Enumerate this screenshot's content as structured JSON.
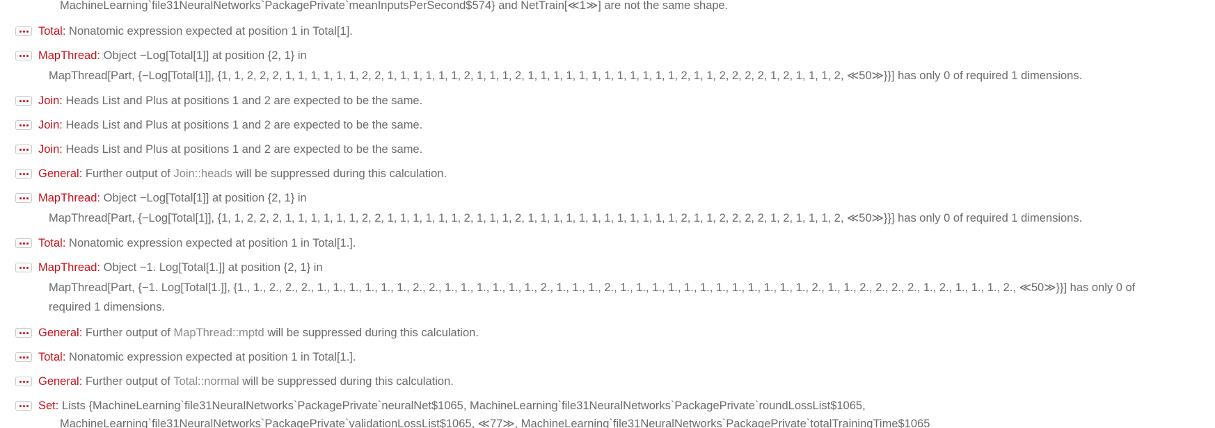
{
  "messages": [
    {
      "line1_text": "MachineLearning`file31NeuralNetworks`PackagePrivate`meanInputsPerSecond$574} and NetTrain[≪1≫] are not the same shape."
    },
    {
      "symbol": "Total:",
      "text": "Nonatomic expression expected at position 1 in Total[1]."
    },
    {
      "symbol": "MapThread:",
      "text": "Object −Log[Total[1]] at position {2, 1} in",
      "line2": "MapThread[Part, {−Log[Total[1]], {1, 1, 2, 2, 2, 1, 1, 1, 1, 1, 1, 2, 2, 1, 1, 1, 1, 1, 1, 2, 1, 1, 1, 2, 1, 1, 1, 1, 1, 1, 1, 1, 1, 1, 1, 1, 2, 1, 1, 2, 2, 2, 2, 1, 2, 1, 1, 1, 2, ≪50≫}}] has only 0 of required 1 dimensions."
    },
    {
      "symbol": "Join:",
      "text": "Heads List and Plus at positions 1 and 2 are expected to be the same."
    },
    {
      "symbol": "Join:",
      "text": "Heads List and Plus at positions 1 and 2 are expected to be the same."
    },
    {
      "symbol": "Join:",
      "text": "Heads List and Plus at positions 1 and 2 are expected to be the same."
    },
    {
      "symbol": "General:",
      "text_before": "Further output of",
      "name": "Join::heads",
      "text_after": "will be suppressed during this calculation."
    },
    {
      "symbol": "MapThread:",
      "text": "Object −Log[Total[1]] at position {2, 1} in",
      "line2": "MapThread[Part, {−Log[Total[1]], {1, 1, 2, 2, 2, 1, 1, 1, 1, 1, 1, 2, 2, 1, 1, 1, 1, 1, 1, 2, 1, 1, 1, 2, 1, 1, 1, 1, 1, 1, 1, 1, 1, 1, 1, 1, 2, 1, 1, 2, 2, 2, 2, 1, 2, 1, 1, 1, 2, ≪50≫}}] has only 0 of required 1 dimensions."
    },
    {
      "symbol": "Total:",
      "text": "Nonatomic expression expected at position 1 in Total[1.]."
    },
    {
      "symbol": "MapThread:",
      "text": "Object −1. Log[Total[1.]] at position {2, 1} in",
      "line2": "MapThread[Part, {−1. Log[Total[1.]], {1., 1., 2., 2., 2., 1., 1., 1., 1., 1., 1., 2., 2., 1., 1., 1., 1., 1., 1., 2., 1., 1., 1., 2., 1., 1., 1., 1., 1., 1., 1., 1., 1., 1., 1., 1., 2., 1., 1., 2., 2., 2., 2., 1., 2., 1., 1., 1., 2., ≪50≫}}] has only 0 of",
      "line3": "required 1 dimensions."
    },
    {
      "symbol": "General:",
      "text_before": "Further output of",
      "name": "MapThread::mptd",
      "text_after": "will be suppressed during this calculation."
    },
    {
      "symbol": "Total:",
      "text": "Nonatomic expression expected at position 1 in Total[1.]."
    },
    {
      "symbol": "General:",
      "text_before": "Further output of",
      "name": "Total::normal",
      "text_after": "will be suppressed during this calculation."
    },
    {
      "symbol": "Set:",
      "text": "Lists {MachineLearning`file31NeuralNetworks`PackagePrivate`neuralNet$1065, MachineLearning`file31NeuralNetworks`PackagePrivate`roundLossList$1065,",
      "line2": "MachineLearning`file31NeuralNetworks`PackagePrivate`validationLossList$1065, ≪77≫, MachineLearning`file31NeuralNetworks`PackagePrivate`totalTrainingTime$1065"
    }
  ],
  "icons": {
    "message_button": "ellipsis-message-icon"
  },
  "colors": {
    "symbol": "#c8101b",
    "text": "#6a6a6a",
    "message_name": "#8a8a8a",
    "button_border": "#c9c9c9"
  }
}
